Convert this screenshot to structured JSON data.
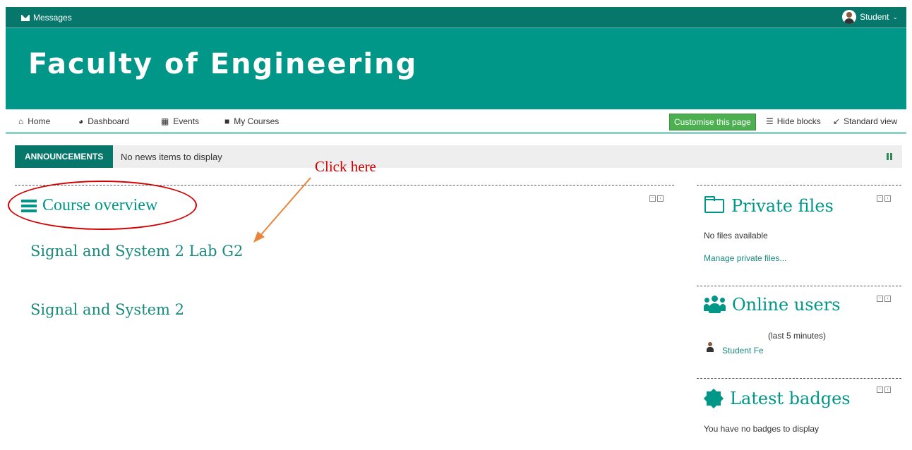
{
  "topbar": {
    "messages": "Messages",
    "user": "Student"
  },
  "banner": {
    "title": "Faculty of Engineering"
  },
  "nav": {
    "items": [
      {
        "label": "Home",
        "icon": "home-icon",
        "glyph": "⌂"
      },
      {
        "label": "Dashboard",
        "icon": "dashboard-icon",
        "glyph": "◕"
      },
      {
        "label": "Events",
        "icon": "calendar-icon",
        "glyph": "▦"
      },
      {
        "label": "My Courses",
        "icon": "briefcase-icon",
        "glyph": "■"
      }
    ],
    "customise": "Customise this page",
    "hide_blocks": "Hide blocks",
    "standard_view": "Standard view"
  },
  "announcements": {
    "label": "ANNOUNCEMENTS",
    "text": "No news items to display"
  },
  "course_overview": {
    "title": "Course overview",
    "courses": [
      "Signal and System 2 Lab G2",
      "Signal and System 2"
    ]
  },
  "annotation": {
    "text": "Click here",
    "color": "#d40000",
    "arrow_color": "#e8843c"
  },
  "private_files": {
    "title": "Private files",
    "empty": "No files available",
    "manage": "Manage private files..."
  },
  "online_users": {
    "title": "Online users",
    "period": "(last 5 minutes)",
    "users": [
      "Student Fe"
    ]
  },
  "badges": {
    "title": "Latest badges",
    "empty": "You have no badges to display"
  },
  "colors": {
    "brand": "#009688",
    "dark": "#08776b",
    "accent_green": "#4caf50"
  }
}
